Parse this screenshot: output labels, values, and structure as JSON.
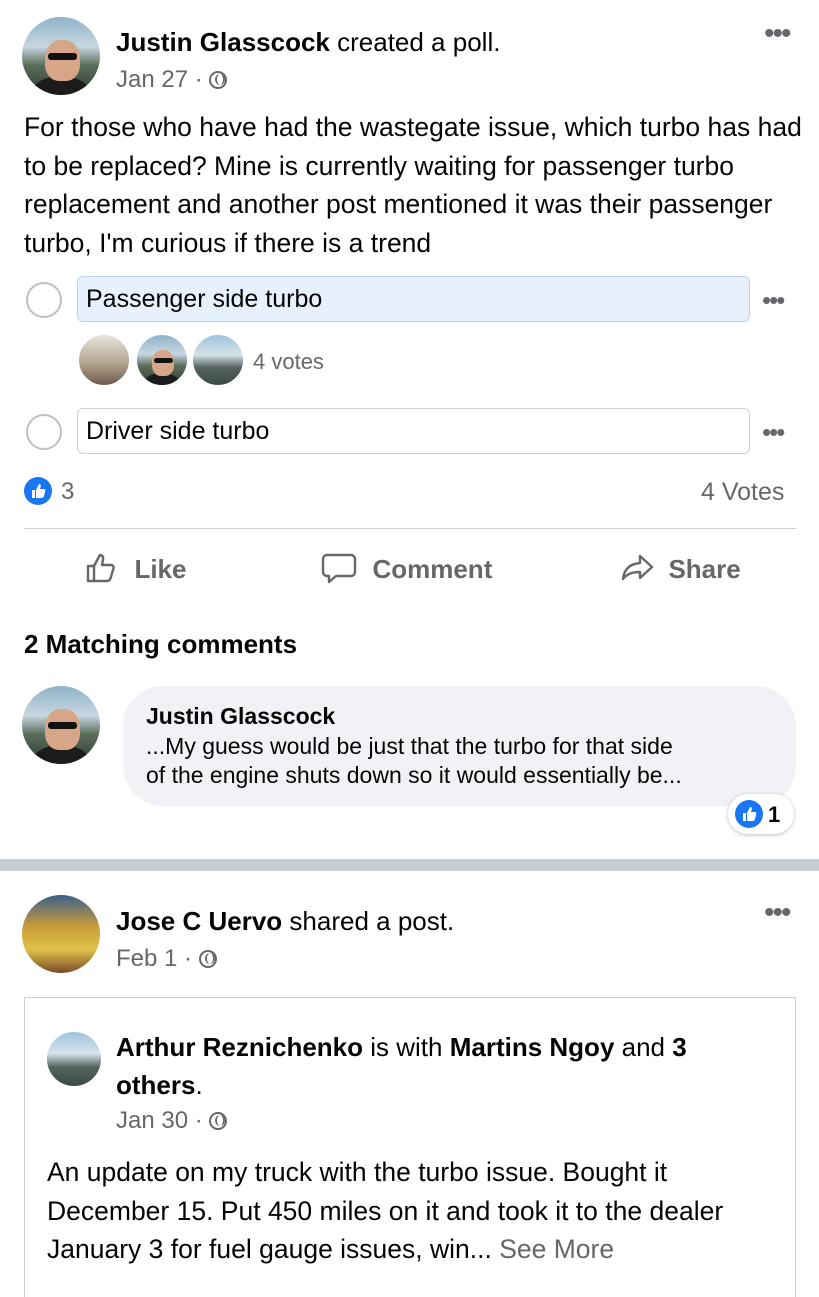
{
  "post1": {
    "author": "Justin Glasscock",
    "action": " created a poll.",
    "date": "Jan 27 ·",
    "text": "For those who have had the wastegate issue, which turbo has had to be replaced? Mine is currently waiting for passenger turbo replacement and another post mentioned it was their passenger turbo, I'm curious if there is a trend",
    "poll": {
      "options": [
        {
          "label": "Passenger side turbo",
          "votes_label": "4 votes"
        },
        {
          "label": "Driver side turbo"
        }
      ]
    },
    "reaction_count": "3",
    "total_votes": "4 Votes",
    "actions": {
      "like": "Like",
      "comment": "Comment",
      "share": "Share"
    },
    "matching_comments_title": "2 Matching comments",
    "comment": {
      "author": "Justin Glasscock",
      "text_line1": "...My guess would be just that the turbo for that side",
      "text_line2": "of the engine shuts down so it would essentially be...",
      "reaction_count": "1"
    }
  },
  "post2": {
    "author": "Jose C Uervo",
    "action": " shared a post.",
    "date": "Feb 1 ·",
    "shared": {
      "author": "Arthur Reznichenko",
      "with_text": " is with ",
      "tagged": "Martins Ngoy",
      "and_text": " and ",
      "others": "3 others",
      "period": ".",
      "date": "Jan 30 ·",
      "text": "An update on my truck with the turbo issue. Bought it December 15. Put 450 miles on it and took it to the dealer January 3 for fuel gauge issues, win...",
      "see_more": " See More"
    }
  },
  "colors": {
    "accent": "#1877f2",
    "secondary_text": "#65676b",
    "selected_option": "#e7f0fd"
  }
}
